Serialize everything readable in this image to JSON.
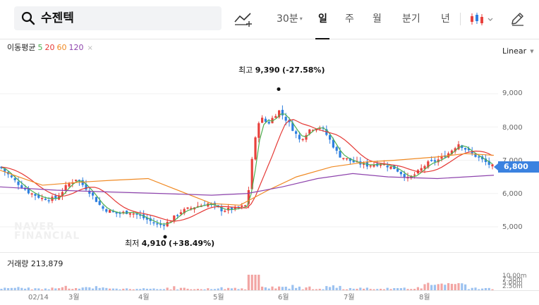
{
  "search": {
    "query": "수젠텍"
  },
  "timeframes": [
    {
      "label": "30분",
      "active": false,
      "has_caret": true
    },
    {
      "label": "일",
      "active": true
    },
    {
      "label": "주",
      "active": false
    },
    {
      "label": "월",
      "active": false
    },
    {
      "label": "분기",
      "active": false
    },
    {
      "label": "년",
      "active": false
    }
  ],
  "indicators": {
    "ma_title": "이동평균",
    "ma_periods": [
      {
        "label": "5",
        "color": "#4caf50"
      },
      {
        "label": "20",
        "color": "#e53935"
      },
      {
        "label": "60",
        "color": "#f08a24"
      },
      {
        "label": "120",
        "color": "#8e44ad"
      }
    ],
    "close_glyph": "×"
  },
  "scale": {
    "label": "Linear"
  },
  "price_axis": {
    "ticks": [
      "9,000",
      "8,000",
      "7,000",
      "6,000",
      "5,000"
    ],
    "current_price": "6,800"
  },
  "annotations": {
    "high": {
      "prefix": "최고",
      "value": "9,390",
      "change": "(-27.58%)"
    },
    "low": {
      "prefix": "최저",
      "value": "4,910",
      "change": "(+38.49%)"
    }
  },
  "watermark": {
    "line1": "NAVER",
    "line2": "FINANCIAL"
  },
  "volume": {
    "title": "거래량",
    "value": "213,879",
    "ticks": [
      "10.00m",
      "7.50m",
      "5.00m",
      "2.50m"
    ]
  },
  "x_axis": {
    "labels": [
      "02/14",
      "3월",
      "4월",
      "5월",
      "6월",
      "7월",
      "8월"
    ]
  },
  "colors": {
    "up": "#e8413d",
    "down": "#2f80e0",
    "accent": "#3b82e0"
  },
  "chart_data": {
    "type": "candlestick",
    "price_range": [
      4500,
      9800
    ],
    "price_ticks": [
      5000,
      6000,
      7000,
      8000,
      9000
    ],
    "high": 9390,
    "low": 4910,
    "last": 6800
  }
}
